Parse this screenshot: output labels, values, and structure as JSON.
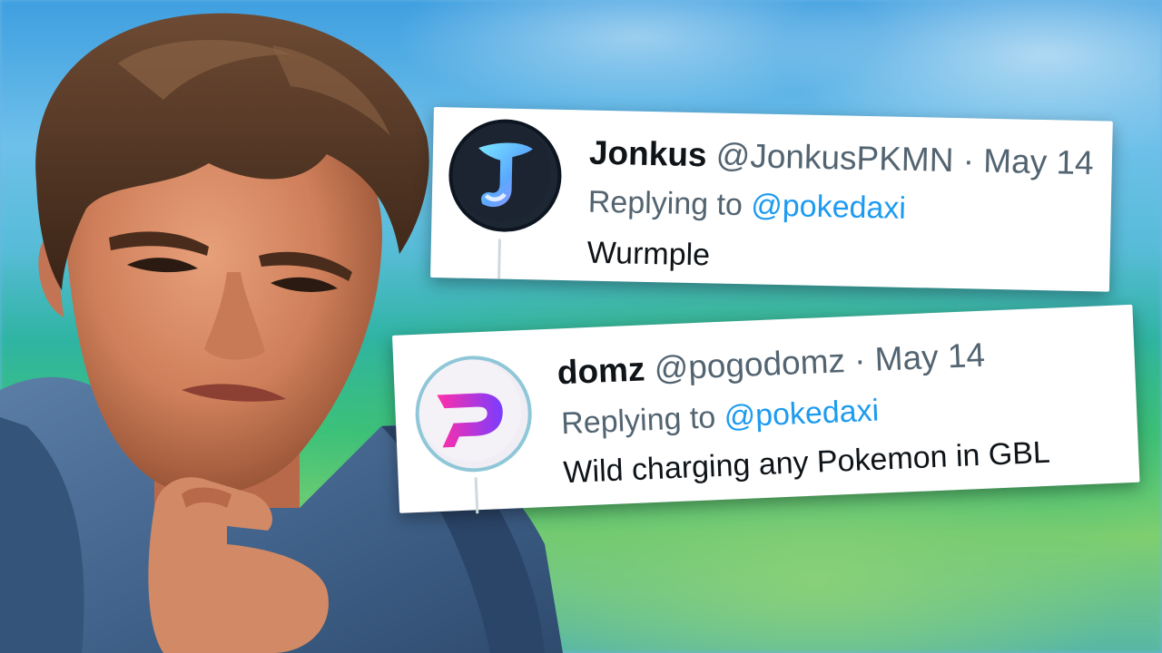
{
  "tweets": [
    {
      "name": "Jonkus",
      "handle": "@JonkusPKMN",
      "separator": "·",
      "date": "May 14",
      "replying_prefix": "Replying to",
      "replying_handle": "@pokedaxi",
      "text": "Wurmple",
      "avatar_icon": "jonkus-logo-icon"
    },
    {
      "name": "domz",
      "handle": "@pogodomz",
      "separator": "·",
      "date": "May 14",
      "replying_prefix": "Replying to",
      "replying_handle": "@pokedaxi",
      "text": "Wild charging any Pokemon in GBL",
      "avatar_icon": "domz-logo-icon"
    }
  ],
  "colors": {
    "name": "#0f1419",
    "meta": "#536471",
    "mention": "#1d9bf0",
    "card": "#ffffff"
  }
}
